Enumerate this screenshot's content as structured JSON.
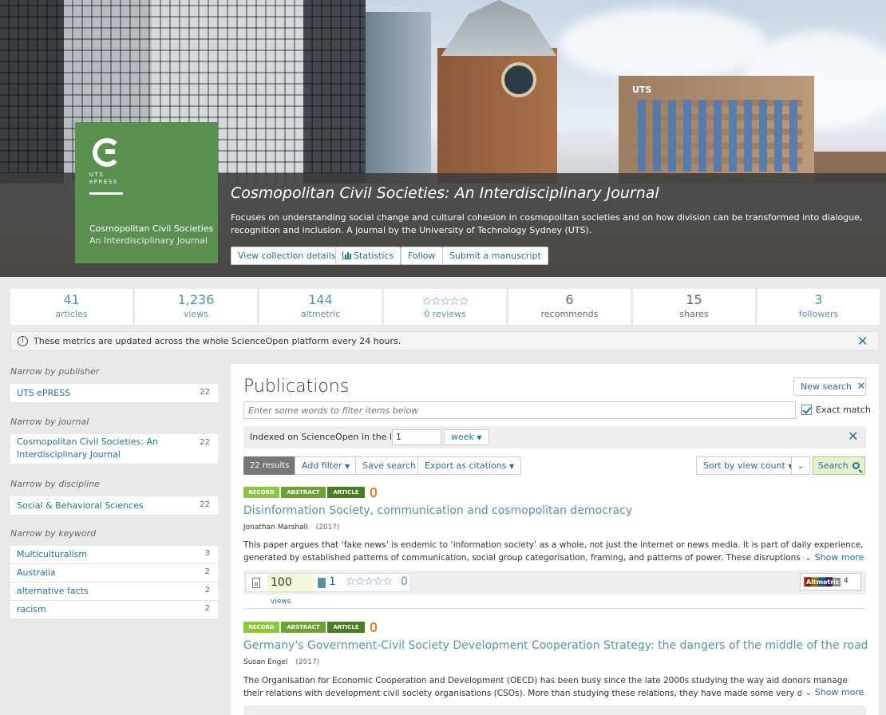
{
  "hero": {
    "logo": {
      "mark": "C",
      "press_line1": "UTS",
      "press_line2": "ePRESS",
      "title_line1": "Cosmopolitan Civil Societies",
      "title_line2": "An Interdisciplinary Journal"
    },
    "title": "Cosmopolitan Civil Societies: An Interdisciplinary Journal",
    "description": "Focuses on understanding social change and cultural cohesion in cosmopolitan societies and on how division can be transformed into dialogue, recognition and inclusion. A journal by the University of Technology Sydney (UTS).",
    "buttons": {
      "details": "View collection details",
      "statistics": "Statistics",
      "follow": "Follow",
      "submit": "Submit a manuscript"
    },
    "building_sign": "UTS"
  },
  "stats": [
    {
      "value": "41",
      "label": "articles"
    },
    {
      "value": "1,236",
      "label": "views"
    },
    {
      "value": "144",
      "label": "altmetric"
    },
    {
      "value": "☆☆☆☆☆",
      "label": "0 reviews"
    },
    {
      "value": "6",
      "label": "recommends"
    },
    {
      "value": "15",
      "label": "shares"
    },
    {
      "value": "3",
      "label": "followers"
    }
  ],
  "info": {
    "icon": "i",
    "text": "These metrics are updated across the whole ScienceOpen platform every 24 hours."
  },
  "sidebar": {
    "publisher_heading": "Narrow by publisher",
    "publishers": [
      {
        "label": "UTS ePRESS",
        "count": "22"
      }
    ],
    "journal_heading": "Narrow by journal",
    "journals": [
      {
        "label": "Cosmopolitan Civil Societies: An Interdisciplinary Journal",
        "count": "22"
      }
    ],
    "discipline_heading": "Narrow by discipline",
    "disciplines": [
      {
        "label": "Social & Behavioral Sciences",
        "count": "22"
      }
    ],
    "keyword_heading": "Narrow by keyword",
    "keywords": [
      {
        "label": "Multiculturalism",
        "count": "3"
      },
      {
        "label": "Australia",
        "count": "2"
      },
      {
        "label": "alternative facts",
        "count": "2"
      },
      {
        "label": "racism",
        "count": "2"
      }
    ]
  },
  "main": {
    "title": "Publications",
    "new_search": "New search",
    "filter_placeholder": "Enter some words to filter items below",
    "exact_match": "Exact match",
    "indexed_label": "Indexed on ScienceOpen in the last",
    "indexed_value": "1",
    "indexed_unit": "week",
    "results": "22 results",
    "add_filter": "Add filter",
    "save_search": "Save search",
    "export": "Export as citations",
    "sort": "Sort by view count",
    "search": "Search",
    "close": "✕"
  },
  "tags": {
    "record": "RECORD",
    "abstract": "ABSTRACT",
    "article": "ARTICLE"
  },
  "articles": [
    {
      "title": "Disinformation Society, communication and cosmopolitan democracy",
      "author": "Jonathan Marshall",
      "year": "(2017)",
      "abstract": "This paper argues that ‘fake news’ is endemic to ‘information society’ as a whole, not just the internet or news media. It is part of daily experience, generated by established patterns of communication, social group categorisation, framing, and patterns of power. These disruptions are intensified  the",
      "show_more": "Show more",
      "views": "100",
      "views_label": "views",
      "bookmarks": "1",
      "stars": "☆☆☆☆☆",
      "rating": "0",
      "altmetric_label": "Altmetric",
      "altmetric": "4"
    },
    {
      "title": "Germany's Government-Civil Society Development Cooperation Strategy: the dangers of the middle of the road",
      "author": "Susan Engel",
      "year": "(2017)",
      "abstract": "The Organisation for Economic Cooperation and Development (OECD) has been busy since the late 2000s studying the way aid donors manage their relations with development civil society organisations (CSOs). More than studying these relations, they have made some very detailed, managerialist and",
      "show_more": "Show more"
    }
  ]
}
